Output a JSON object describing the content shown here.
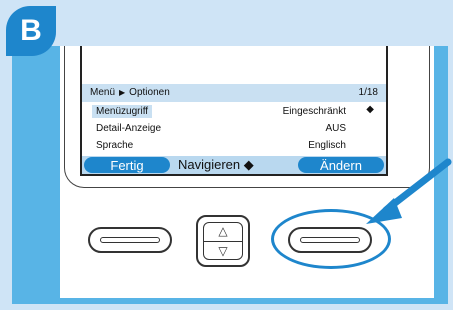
{
  "badge": "B",
  "screen": {
    "breadcrumb_root": "Menü",
    "breadcrumb_current": "Optionen",
    "page_indicator": "1/18",
    "rows": [
      {
        "label": "Menüzugriff",
        "value": "Eingeschränkt",
        "selected": true
      },
      {
        "label": "Detail-Anzeige",
        "value": "AUS"
      },
      {
        "label": "Sprache",
        "value": "Englisch"
      }
    ],
    "softkeys": {
      "left": "Fertig",
      "middle": "Navigieren",
      "right": "Ändern"
    }
  },
  "colors": {
    "accent": "#1e86cc",
    "panel_bg": "#cfe4f6",
    "inner_bg": "#58b4e6",
    "highlight": "#c9e0f2"
  },
  "icons": {
    "breadcrumb_separator": "triangle-right-icon",
    "updown": "up-down-arrows-icon",
    "nav_up": "triangle-up-icon",
    "nav_down": "triangle-down-icon",
    "pointer": "arrow-pointer-icon"
  }
}
